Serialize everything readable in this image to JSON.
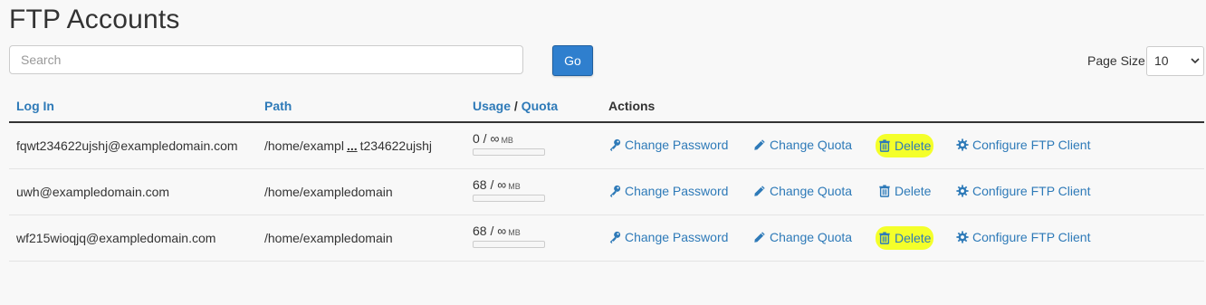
{
  "page": {
    "title": "FTP Accounts"
  },
  "search": {
    "placeholder": "Search",
    "go_label": "Go"
  },
  "page_size": {
    "label": "Page Size",
    "value": "10"
  },
  "table": {
    "headers": {
      "login": "Log In",
      "path": "Path",
      "usage": "Usage",
      "separator": "/",
      "quota": "Quota",
      "actions": "Actions"
    },
    "rows": [
      {
        "login": "fqwt234622ujshj@exampledomain.com",
        "path_start": "/home/exampl",
        "path_ellipsis": "...",
        "path_end": "t234622ujshj",
        "usage": "0 / ∞",
        "unit": "MB",
        "highlight_delete": true
      },
      {
        "login": "uwh@exampledomain.com",
        "path_start": "/home/exampledomain",
        "path_ellipsis": "",
        "path_end": "",
        "usage": "68 / ∞",
        "unit": "MB",
        "highlight_delete": false
      },
      {
        "login": "wf215wioqjq@exampledomain.com",
        "path_start": "/home/exampledomain",
        "path_ellipsis": "",
        "path_end": "",
        "usage": "68 / ∞",
        "unit": "MB",
        "highlight_delete": true
      }
    ],
    "actions": {
      "change_password": "Change Password",
      "change_quota": "Change Quota",
      "delete": "Delete",
      "configure": "Configure FTP Client"
    }
  },
  "colors": {
    "link": "#2e7ab8",
    "button": "#2f7fce",
    "highlight": "#f4ff2a"
  },
  "icons": {
    "change_password": "key-icon",
    "change_quota": "pencil-icon",
    "delete": "trash-icon",
    "configure": "gear-icon"
  }
}
